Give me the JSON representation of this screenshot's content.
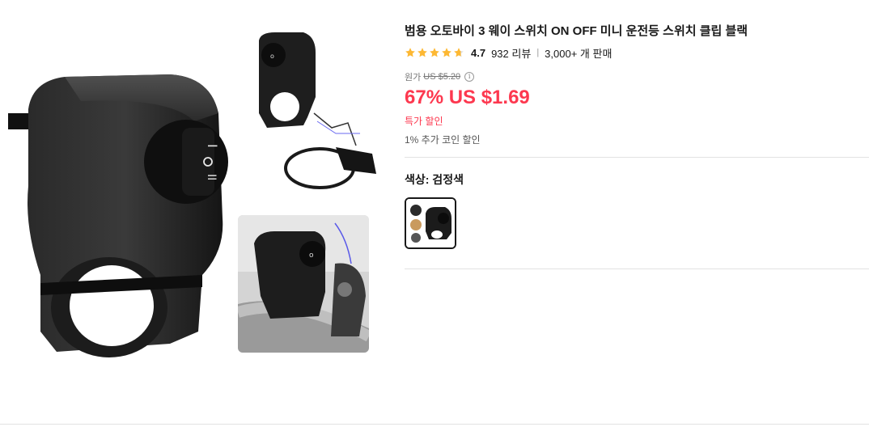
{
  "product": {
    "title": "범용 오토바이 3 웨이 스위치 ON OFF 미니 운전등 스위치 클립 블랙",
    "rating": "4.7",
    "stars": 4.7,
    "reviews": "932 리뷰",
    "separator": "|",
    "sold": "3,000+ 개 판매",
    "original_label": "원가",
    "original_price": "US $5.20",
    "info_icon": "i",
    "discount_price": "67% US $1.69",
    "deal_label": "특가 할인",
    "coin_text": "1% 추가 코인 할인",
    "color_label": "색상: 검정색"
  },
  "colors": {
    "accent": "#fd384f",
    "star": "#fdb833",
    "text": "#191919",
    "muted": "#757575"
  }
}
